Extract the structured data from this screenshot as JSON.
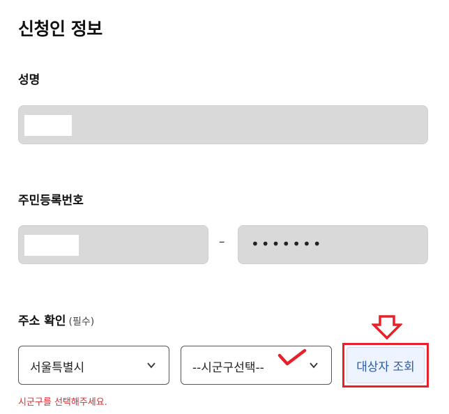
{
  "section": {
    "title": "신청인 정보"
  },
  "name": {
    "label": "성명"
  },
  "rrn": {
    "label": "주민등록번호",
    "separator": "–",
    "back_value": "•••••••"
  },
  "address": {
    "label": "주소 확인",
    "required_note": "(필수)",
    "city_select": {
      "value": "서울특별시"
    },
    "district_select": {
      "value": "--시군구선택--"
    },
    "search_button": {
      "label": "대상자 조회"
    },
    "error_message": "시군구를 선택해주세요."
  },
  "colors": {
    "accent_blue": "#2c5aa0",
    "error_red": "#e0262e",
    "annotation_red": "#e8202a",
    "disabled_bg": "#d9d9d9"
  },
  "icons": {
    "chevron": "chevron-down-icon",
    "arrow": "down-arrow-annotation",
    "check": "checkmark-annotation"
  }
}
